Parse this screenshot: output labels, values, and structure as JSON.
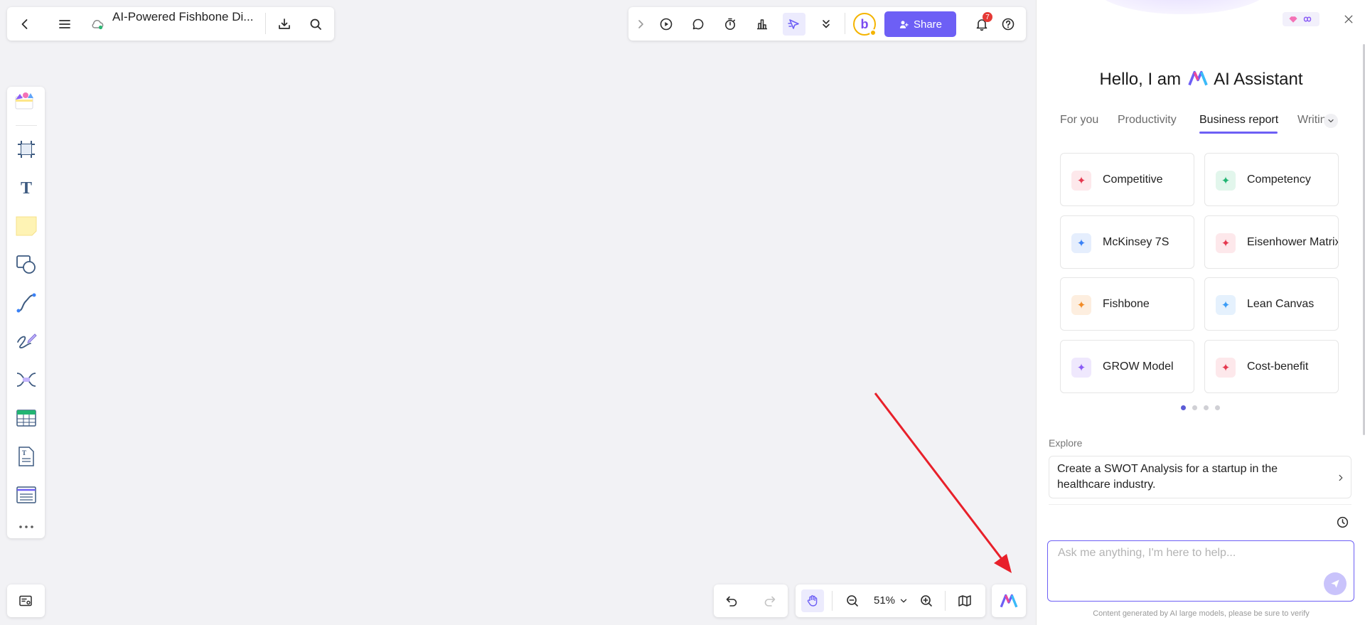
{
  "header": {
    "doc_title": "AI-Powered Fishbone Di...",
    "share_label": "Share",
    "notification_count": "7"
  },
  "bottom": {
    "zoom": "51%"
  },
  "ai_panel": {
    "title_prefix": "Hello, I am",
    "title_suffix": "AI Assistant",
    "tabs": [
      {
        "label": "For you"
      },
      {
        "label": "Productivity"
      },
      {
        "label": "Business report"
      },
      {
        "label": "Writin"
      }
    ],
    "active_tab": "Business report",
    "cards": [
      {
        "label": "Competitive",
        "color": "#e53950"
      },
      {
        "label": "Competency",
        "color": "#22b573"
      },
      {
        "label": "McKinsey 7S",
        "color": "#3b82f6"
      },
      {
        "label": "Eisenhower Matrix",
        "color": "#e53950"
      },
      {
        "label": "Fishbone",
        "color": "#f28c28"
      },
      {
        "label": "Lean Canvas",
        "color": "#3b9cf6"
      },
      {
        "label": "GROW Model",
        "color": "#8b5cf6"
      },
      {
        "label": "Cost-benefit",
        "color": "#e53950"
      }
    ],
    "page_count": 4,
    "current_page": 1,
    "explore_label": "Explore",
    "explore_prompt": "Create a SWOT Analysis for a startup in the healthcare industry.",
    "input_placeholder": "Ask me anything, I'm here to help...",
    "footer_note": "Content generated by AI large models, please be sure to verify"
  },
  "colors": {
    "accent": "#6d5ff5",
    "annotation_arrow": "#e8202a"
  }
}
